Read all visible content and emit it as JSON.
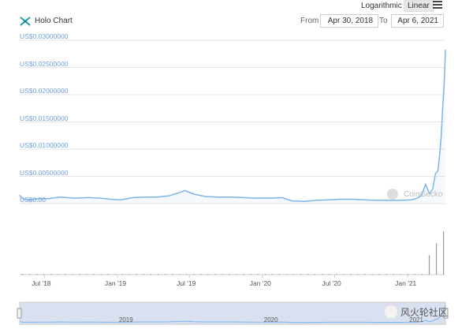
{
  "header": {
    "scale_log": "Logarithmic",
    "scale_linear": "Linear",
    "title": "Holo Chart",
    "from_label": "From",
    "from_value": "Apr 30, 2018",
    "to_label": "To",
    "to_value": "Apr 6, 2021"
  },
  "credit": "CoinGecko",
  "watermark": "风火轮社区",
  "chart_data": {
    "type": "line",
    "title": "Holo Chart",
    "xlabel": "",
    "ylabel": "",
    "y_ticks": [
      "US$0.03000000",
      "US$0.02500000",
      "US$0.02000000",
      "US$0.01500000",
      "US$0.01000000",
      "US$0.00500000",
      "US$0.00"
    ],
    "y_tick_values": [
      0.03,
      0.025,
      0.02,
      0.015,
      0.01,
      0.005,
      0.0
    ],
    "x_ticks": [
      "Jul '18",
      "Jan '19",
      "Jul '19",
      "Jan '20",
      "Jul '20",
      "Jan '21"
    ],
    "x_tick_dates": [
      "2018-07-01",
      "2019-01-01",
      "2019-07-01",
      "2020-01-01",
      "2020-07-01",
      "2021-01-01"
    ],
    "xlim": [
      "2018-04-30",
      "2021-04-06"
    ],
    "ylim": [
      0,
      0.03
    ],
    "grid": true,
    "navigator_labels": [
      "2019",
      "2020",
      "2021"
    ],
    "series": [
      {
        "name": "",
        "x": [
          "2018-04-30",
          "2018-05-10",
          "2018-05-25",
          "2018-06-15",
          "2018-07-10",
          "2018-08-10",
          "2018-09-15",
          "2018-10-20",
          "2018-11-20",
          "2018-12-15",
          "2019-01-10",
          "2019-02-10",
          "2019-03-10",
          "2019-04-10",
          "2019-05-10",
          "2019-06-01",
          "2019-06-20",
          "2019-07-10",
          "2019-08-10",
          "2019-09-10",
          "2019-10-15",
          "2019-11-15",
          "2019-12-15",
          "2020-01-20",
          "2020-02-20",
          "2020-03-15",
          "2020-04-15",
          "2020-05-15",
          "2020-06-15",
          "2020-07-15",
          "2020-08-15",
          "2020-09-15",
          "2020-10-15",
          "2020-11-15",
          "2020-12-15",
          "2021-01-10",
          "2021-01-25",
          "2021-02-05",
          "2021-02-15",
          "2021-02-25",
          "2021-03-05",
          "2021-03-12",
          "2021-03-18",
          "2021-03-22",
          "2021-03-26",
          "2021-03-30",
          "2021-04-02",
          "2021-04-04",
          "2021-04-06"
        ],
        "values": [
          0.0015,
          0.0008,
          0.0007,
          0.0009,
          0.0009,
          0.0012,
          0.001,
          0.0011,
          0.001,
          0.0008,
          0.0007,
          0.0011,
          0.0012,
          0.0012,
          0.0014,
          0.0019,
          0.0024,
          0.0018,
          0.0013,
          0.0012,
          0.0012,
          0.0011,
          0.001,
          0.001,
          0.0011,
          0.0005,
          0.0004,
          0.0006,
          0.0007,
          0.0008,
          0.0008,
          0.0007,
          0.0006,
          0.0006,
          0.0006,
          0.0007,
          0.001,
          0.0015,
          0.0035,
          0.0018,
          0.0027,
          0.0055,
          0.006,
          0.0085,
          0.012,
          0.0175,
          0.021,
          0.024,
          0.0282
        ]
      }
    ]
  }
}
